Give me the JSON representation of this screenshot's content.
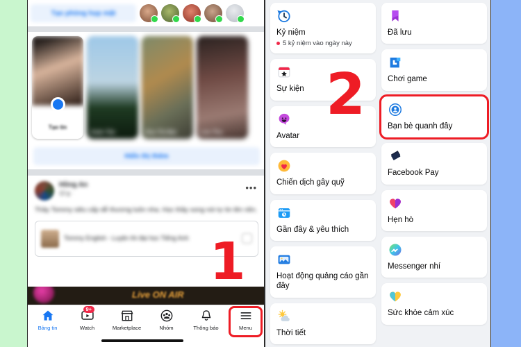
{
  "colors": {
    "left_band": "#c9f6ce",
    "right_band": "#8cb4f8",
    "facebook_blue": "#1877f2",
    "annotation_red": "#ee1c25",
    "badge_red": "#f02849",
    "menu_bg": "#f0f2f5"
  },
  "annotations": {
    "step_one": "1",
    "step_two": "2"
  },
  "left_panel": {
    "composer": {
      "room_button": "Tạo phòng họp mặt"
    },
    "stories": {
      "create_label": "Tạo tin",
      "items": [
        {
          "name": "Tạo tin"
        },
        {
          "name": "Xuân Tân"
        },
        {
          "name": "Hoa Thị Mai"
        },
        {
          "name": "Lưu Thu"
        }
      ]
    },
    "show_more_button": "Hiển thị thêm",
    "post": {
      "author": "Hồng An",
      "meta": "12 g ·",
      "body": "Thầy Tommy siêu cấp dễ thương luôn nha. Học thầy xong nói tự tin lên nền.",
      "card_title": "Tommy English - Luyện thi đại học Tiếng Anh",
      "menu_icon": "more-options-icon"
    },
    "banner_text": "Live ON AIR",
    "bottom_nav": [
      {
        "label": "Bảng tin",
        "icon": "home-icon",
        "active": true,
        "badge": ""
      },
      {
        "label": "Watch",
        "icon": "watch-icon",
        "active": false,
        "badge": "9+"
      },
      {
        "label": "Marketplace",
        "icon": "marketplace-icon",
        "active": false,
        "badge": ""
      },
      {
        "label": "Nhóm",
        "icon": "groups-icon",
        "active": false,
        "badge": ""
      },
      {
        "label": "Thông báo",
        "icon": "bell-icon",
        "active": false,
        "badge": ""
      },
      {
        "label": "Menu",
        "icon": "hamburger-menu-icon",
        "active": false,
        "badge": "",
        "highlighted": true
      }
    ]
  },
  "right_panel": {
    "left_column": [
      {
        "label": "Kỷ niệm",
        "sub": "5 kỷ niệm vào ngày này",
        "icon": "memories-clock-icon"
      },
      {
        "label": "Sự kiện",
        "sub": "",
        "icon": "events-calendar-icon"
      },
      {
        "label": "Avatar",
        "sub": "",
        "icon": "avatar-icon"
      },
      {
        "label": "Chiến dịch gây quỹ",
        "sub": "",
        "icon": "fundraiser-heart-icon"
      },
      {
        "label": "Gần đây & yêu thích",
        "sub": "",
        "icon": "recent-favorites-icon"
      },
      {
        "label": "Hoạt động quảng cáo gần đây",
        "sub": "",
        "icon": "ad-activity-icon"
      },
      {
        "label": "Thời tiết",
        "sub": "",
        "icon": "weather-sun-cloud-icon"
      }
    ],
    "right_column": [
      {
        "label": "Đã lưu",
        "sub": "",
        "icon": "saved-bookmark-icon"
      },
      {
        "label": "Chơi game",
        "sub": "",
        "icon": "gaming-icon"
      },
      {
        "label": "Bạn bè quanh đây",
        "sub": "",
        "icon": "nearby-friends-icon",
        "highlighted": true
      },
      {
        "label": "Facebook Pay",
        "sub": "",
        "icon": "facebook-pay-icon"
      },
      {
        "label": "Hẹn hò",
        "sub": "",
        "icon": "dating-heart-icon"
      },
      {
        "label": "Messenger nhí",
        "sub": "",
        "icon": "messenger-kids-icon"
      },
      {
        "label": "Sức khỏe cảm xúc",
        "sub": "",
        "icon": "emotional-health-icon"
      }
    ]
  }
}
